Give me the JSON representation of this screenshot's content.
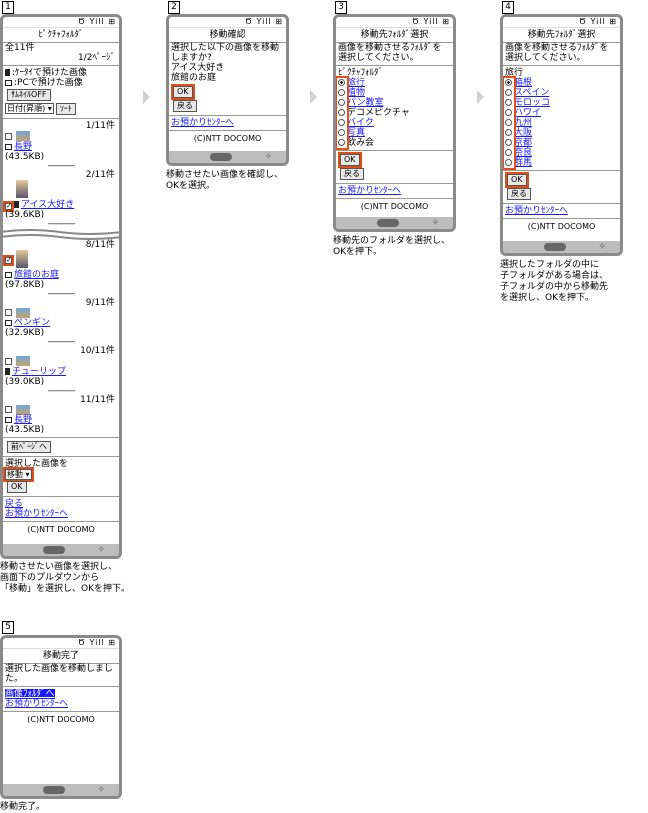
{
  "steps": [
    {
      "num": "1",
      "caption": "移動させたい画像を選択し、\n画面下のプルダウンから\n「移動」を選択し、OKを押下。"
    },
    {
      "num": "2",
      "caption": "移動させたい画像を確認し、\nOKを選択。"
    },
    {
      "num": "3",
      "caption": "移動先のフォルダを選択し、\nOKを押下。"
    },
    {
      "num": "4",
      "caption": "選択したフォルダの中に\n子フォルダがある場合は、\n子フォルダの中から移動先\nを選択し、OKを押下。"
    },
    {
      "num": "5",
      "caption": "移動完了。"
    }
  ],
  "status_icons": "Ծ Yill ⊞",
  "footer": "(C)NTT DOCOMO",
  "screen1": {
    "title": "ﾋﾟｸﾁｬﾌｫﾙﾀﾞ",
    "count": "全11件",
    "page": "1/2ﾍﾟｰｼﾞ",
    "legend_phone": ":ｹｰﾀｲで預けた画像",
    "legend_pc": ":PCで預けた画像",
    "thumb_toggle": "ｻﾑﾈｲﾙOFF",
    "sort_select": "日付(昇順)",
    "sort_button": "ｿｰﾄ",
    "items": [
      {
        "idx": "1/11件",
        "name": "長野",
        "size": "(43.5KB)",
        "checked": false
      },
      {
        "idx": "2/11件",
        "name": "アイス大好き",
        "size": "(39.6KB)",
        "checked": true
      },
      {
        "idx": "8/11件",
        "name": "旅館のお庭",
        "size": "(97.8KB)",
        "checked": true
      },
      {
        "idx": "9/11件",
        "name": "ペンギン",
        "size": "(32.9KB)",
        "checked": false
      },
      {
        "idx": "10/11件",
        "name": "チューリップ",
        "size": "(39.0KB)",
        "checked": false
      },
      {
        "idx": "11/11件",
        "name": "長野",
        "size": "(43.5KB)",
        "checked": false
      }
    ],
    "prev_page": "前ﾍﾟｰｼﾞへ",
    "action_label": "選択した画像を",
    "action_select": "移動",
    "ok": "OK",
    "back": "戻る",
    "center_link": "お預かりｾﾝﾀｰへ"
  },
  "screen2": {
    "title": "移動確認",
    "lines": [
      "選択した以下の画像を移動",
      "しますか?",
      "アイス大好き",
      "旅館のお庭"
    ],
    "ok": "OK",
    "back": "戻る",
    "center_link": "お預かりｾﾝﾀｰへ"
  },
  "screen3": {
    "title": "移動先ﾌｫﾙﾀﾞ選択",
    "lines": [
      "画像を移動させるﾌｫﾙﾀﾞを",
      "選択してください。"
    ],
    "folder_root": "ﾋﾟｸﾁｬﾌｫﾙﾀﾞ",
    "folders": [
      "旅行",
      "植物",
      "パン教室",
      "デコメピクチャ",
      "バイク",
      "写真",
      "飲み会"
    ],
    "linked": [
      true,
      true,
      true,
      false,
      true,
      true,
      false
    ],
    "selected": 0,
    "ok": "OK",
    "back": "戻る",
    "center_link": "お預かりｾﾝﾀｰへ"
  },
  "screen4": {
    "title": "移動先ﾌｫﾙﾀﾞ選択",
    "lines": [
      "画像を移動させるﾌｫﾙﾀﾞを",
      "選択してください。"
    ],
    "folder_root": "旅行",
    "folders": [
      "箱根",
      "スペイン",
      "モロッコ",
      "ハワイ",
      "九州",
      "大阪",
      "京都",
      "奈良",
      "群馬"
    ],
    "selected": 0,
    "ok": "OK",
    "back": "戻る",
    "center_link": "お預かりｾﾝﾀｰへ"
  },
  "screen5": {
    "title": "移動完了",
    "message": "選択した画像を移動しました。",
    "folder_link": "画像ﾌｫﾙﾀﾞへ",
    "center_link": "お預かりｾﾝﾀｰへ"
  }
}
